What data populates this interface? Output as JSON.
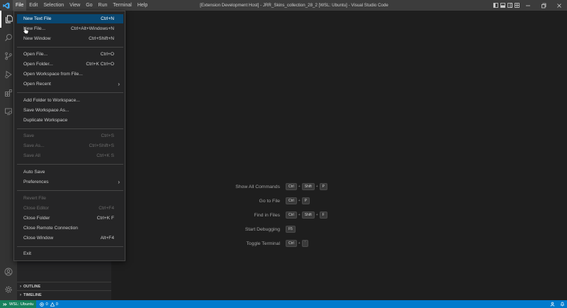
{
  "titlebar": {
    "menus": [
      "File",
      "Edit",
      "Selection",
      "View",
      "Go",
      "Run",
      "Terminal",
      "Help"
    ],
    "title": "[Extension Development Host] - JRR_Skins_collection_28_2 [WSL: Ubuntu] - Visual Studio Code",
    "minimize_icon": "minimize-icon",
    "restore_icon": "restore-icon",
    "close_icon": "close-icon"
  },
  "file_menu": {
    "items": [
      {
        "label": "New Text File",
        "shortcut": "Ctrl+N"
      },
      {
        "label": "New File...",
        "shortcut": "Ctrl+Alt+Windows+N"
      },
      {
        "label": "New Window",
        "shortcut": "Ctrl+Shift+N"
      },
      {
        "label": "Open File...",
        "shortcut": "Ctrl+O"
      },
      {
        "label": "Open Folder...",
        "shortcut": "Ctrl+K Ctrl+O"
      },
      {
        "label": "Open Workspace from File...",
        "shortcut": ""
      },
      {
        "label": "Open Recent",
        "shortcut": ""
      },
      {
        "label": "Add Folder to Workspace...",
        "shortcut": ""
      },
      {
        "label": "Save Workspace As...",
        "shortcut": ""
      },
      {
        "label": "Duplicate Workspace",
        "shortcut": ""
      },
      {
        "label": "Save",
        "shortcut": "Ctrl+S"
      },
      {
        "label": "Save As...",
        "shortcut": "Ctrl+Shift+S"
      },
      {
        "label": "Save All",
        "shortcut": "Ctrl+K S"
      },
      {
        "label": "Auto Save",
        "shortcut": ""
      },
      {
        "label": "Preferences",
        "shortcut": ""
      },
      {
        "label": "Revert File",
        "shortcut": ""
      },
      {
        "label": "Close Editor",
        "shortcut": "Ctrl+F4"
      },
      {
        "label": "Close Folder",
        "shortcut": "Ctrl+K F"
      },
      {
        "label": "Close Remote Connection",
        "shortcut": ""
      },
      {
        "label": "Close Window",
        "shortcut": "Alt+F4"
      },
      {
        "label": "Exit",
        "shortcut": ""
      }
    ]
  },
  "sidebar": {
    "outline": "OUTLINE",
    "timeline": "TIMELINE"
  },
  "editor_watermark": {
    "rows": [
      {
        "label": "Show All Commands",
        "keys": [
          "Ctrl",
          "Shift",
          "P"
        ]
      },
      {
        "label": "Go to File",
        "keys": [
          "Ctrl",
          "P"
        ]
      },
      {
        "label": "Find in Files",
        "keys": [
          "Ctrl",
          "Shift",
          "F"
        ]
      },
      {
        "label": "Start Debugging",
        "keys": [
          "F5"
        ]
      },
      {
        "label": "Toggle Terminal",
        "keys": [
          "Ctrl",
          "`"
        ]
      }
    ]
  },
  "statusbar": {
    "remote": "WSL: Ubuntu",
    "errors": "0",
    "warnings": "0"
  },
  "colors": {
    "accent": "#007acc",
    "remote": "#16825d",
    "menu_highlight": "#094771"
  }
}
